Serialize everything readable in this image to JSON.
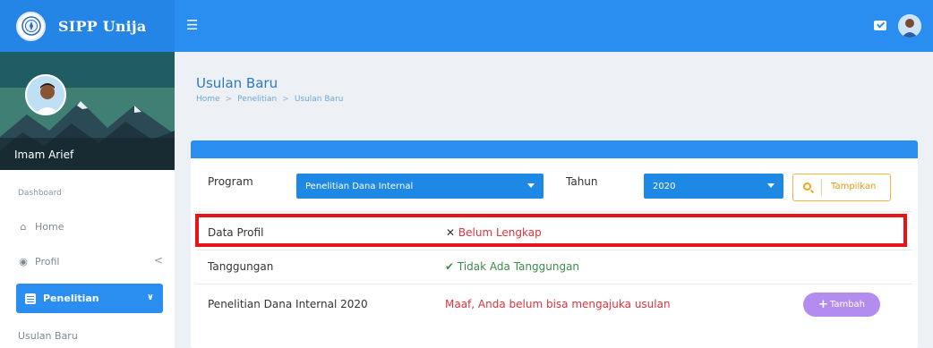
{
  "brand": {
    "name": "SIPP Unija"
  },
  "colors": {
    "primary": "#2a8ef0",
    "danger": "#e0323a",
    "success": "#3c8c4a",
    "warning": "#f2a51a",
    "accent": "#b48cf0"
  },
  "topbar": {
    "menu_icon": "hamburger-icon",
    "mail_icon": "mail-icon",
    "avatar_icon": "user-avatar"
  },
  "sidebar": {
    "user_name": "Imam Arief",
    "section_label": "Dashboard",
    "items": [
      {
        "label": "Home",
        "icon": "home-icon"
      },
      {
        "label": "Profil",
        "icon": "user-icon",
        "chevron": "<"
      },
      {
        "label": "Penelitian",
        "icon": "list-icon",
        "chevron": "∨",
        "active": true
      }
    ],
    "sub_items": [
      {
        "label": "Usulan Baru"
      }
    ]
  },
  "page": {
    "title": "Usulan Baru",
    "breadcrumb": [
      "Home",
      "Penelitian",
      "Usulan Baru"
    ],
    "breadcrumb_sep": ">"
  },
  "filters": {
    "program_label": "Program",
    "program_value": "Penelitian Dana Internal",
    "tahun_label": "Tahun",
    "tahun_value": "2020",
    "search_button": "Tampilkan"
  },
  "status_rows": [
    {
      "label": "Data Profil",
      "status_icon": "✕",
      "status": "Belum Lengkap"
    },
    {
      "label": "Tanggungan",
      "status_icon": "✔",
      "status": "Tidak Ada Tanggungan"
    },
    {
      "label": "Penelitian Dana Internal 2020",
      "status": "Maaf, Anda belum bisa mengajuka usulan",
      "button": "Tambah"
    }
  ]
}
